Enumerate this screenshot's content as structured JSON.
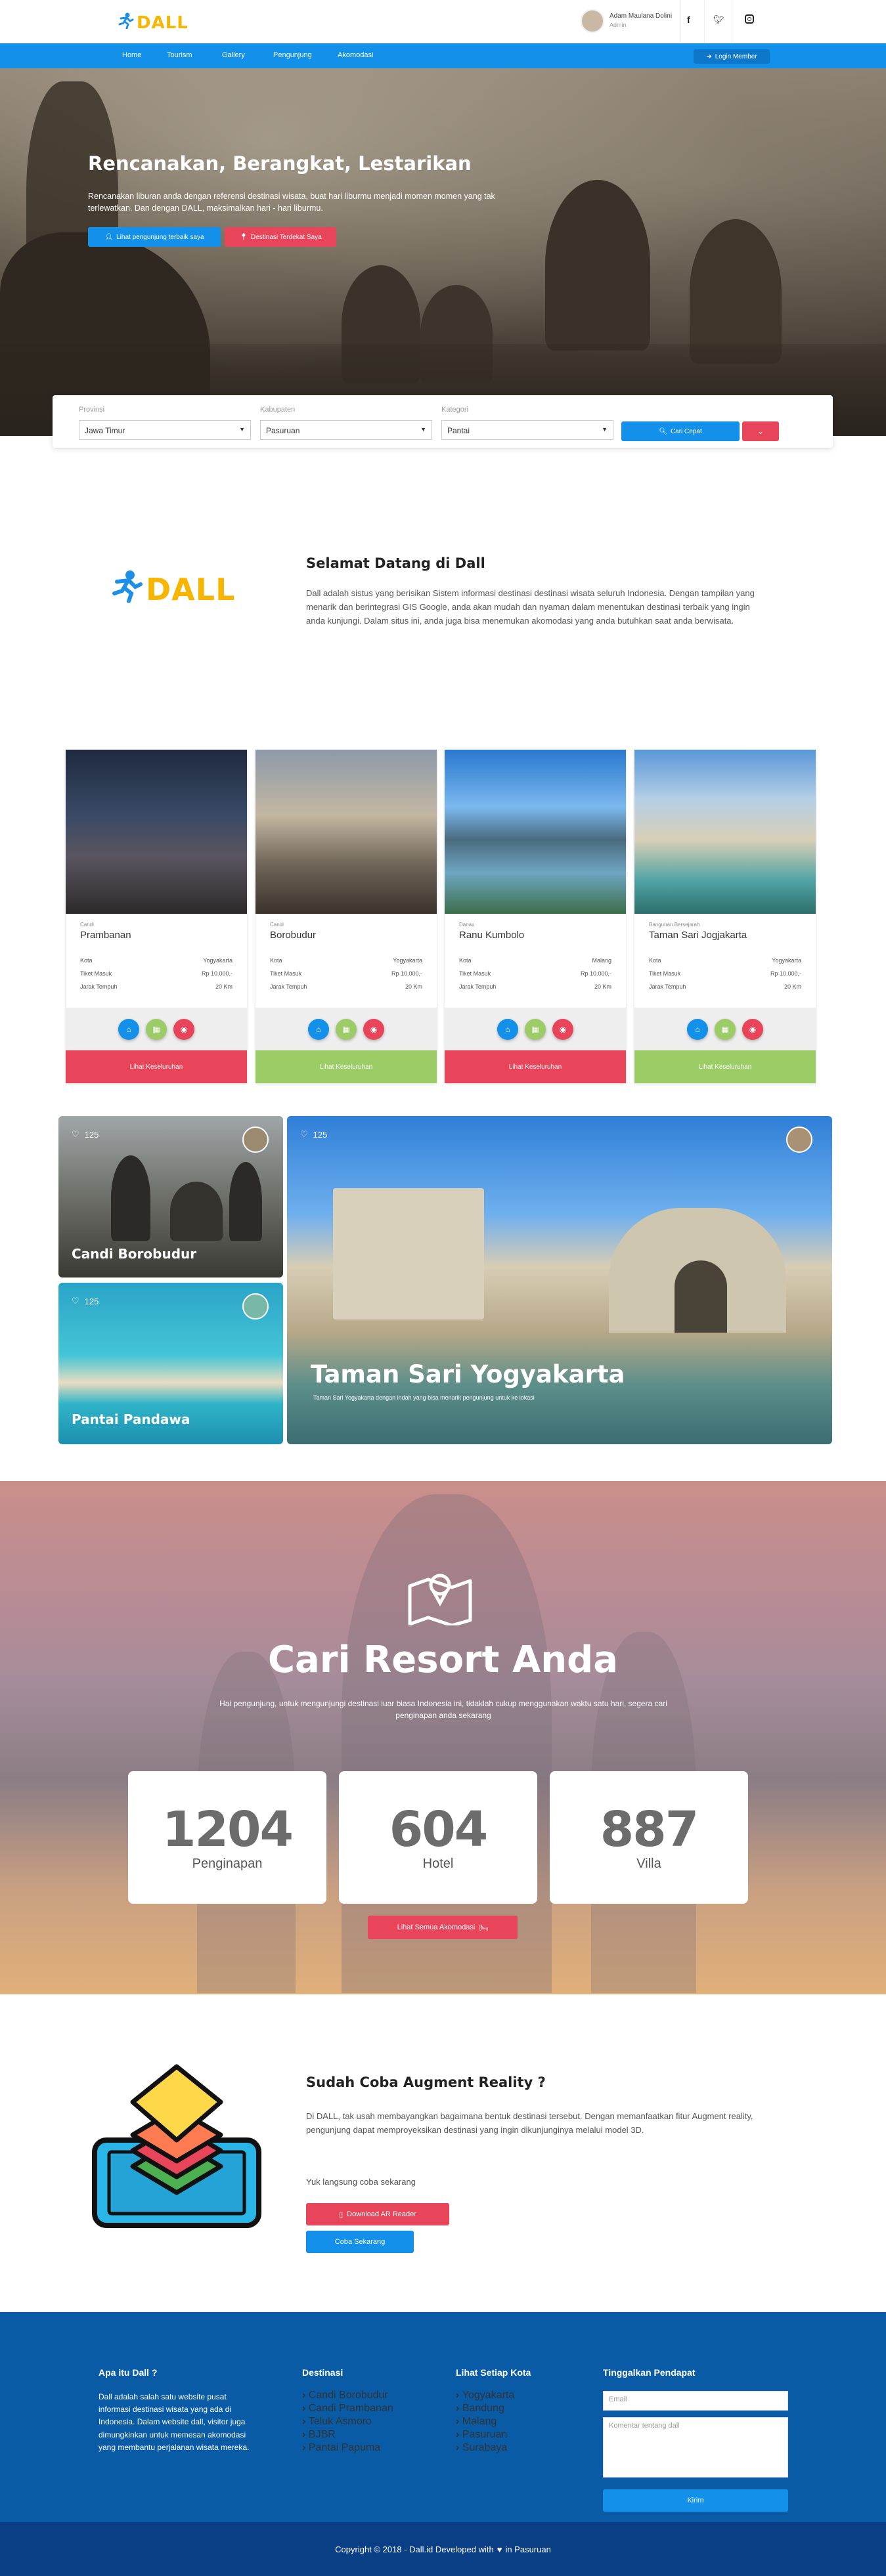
{
  "brand": {
    "logo_text": "DALL",
    "colors": {
      "primary": "#1391ea",
      "accent": "#f7b500",
      "danger": "#e8455a",
      "success": "#9ccc65",
      "footer": "#0a5ba5",
      "copyright_bar": "#0a3f85"
    }
  },
  "user": {
    "name": "Adam Maulana Dolini",
    "role": "Admin"
  },
  "social": [
    "facebook-icon",
    "twitter-icon",
    "instagram-icon"
  ],
  "nav": {
    "items": [
      "Home",
      "Tourism",
      "Gallery",
      "Pengunjung",
      "Akomodasi"
    ],
    "login": "Login Member"
  },
  "hero": {
    "title": "Rencanakan, Berangkat, Lestarikan",
    "text": "Rencanakan liburan anda dengan referensi destinasi wisata, buat hari liburmu menjadi momen momen yang tak terlewatkan. Dan dengan DALL, maksimalkan hari - hari liburmu.",
    "btn_primary": "Lihat pengunjung terbaik saya",
    "btn_secondary": "Destinasi Terdekat Saya"
  },
  "search": {
    "fields": [
      {
        "label": "Provinsi",
        "value": "Jawa Timur"
      },
      {
        "label": "Kabupaten",
        "value": "Pasuruan"
      },
      {
        "label": "Kategori",
        "value": "Pantai"
      }
    ],
    "search_label": "Cari Cepat"
  },
  "welcome": {
    "title": "Selamat Datang di Dall",
    "text": "Dall adalah sistus yang berisikan Sistem informasi destinasi destinasi wisata seluruh Indonesia. Dengan tampilan yang menarik dan berintegrasi GIS Google, anda akan mudah dan nyaman dalam menentukan destinasi terbaik yang ingin anda kunjungi. Dalam situs ini, anda juga bisa menemukan akomodasi yang anda butuhkan saat anda berwisata."
  },
  "destinations": [
    {
      "category": "Candi",
      "name": "Prambanan",
      "kota": "Yogyakarta",
      "tiket": "Rp 10.000,-",
      "jarak": "20 Km",
      "button": "Lihat Keseluruhan",
      "color": "#e8455a"
    },
    {
      "category": "Candi",
      "name": "Borobudur",
      "kota": "Yogyakarta",
      "tiket": "Rp 10.000,-",
      "jarak": "20 Km",
      "button": "Lihat Keseluruhan",
      "color": "#9ccc65"
    },
    {
      "category": "Danau",
      "name": "Ranu Kumbolo",
      "kota": "Malang",
      "tiket": "Rp 10.000,-",
      "jarak": "20 Km",
      "button": "Lihat Keseluruhan",
      "color": "#e8455a"
    },
    {
      "category": "Bangunan Bersejarah",
      "name": "Taman Sari Jogjakarta",
      "kota": "Yogyakarta",
      "tiket": "Rp 10.000,-",
      "jarak": "20 Km",
      "button": "Lihat Keseluruhan",
      "color": "#9ccc65"
    }
  ],
  "row_labels": {
    "kota": "Kota",
    "tiket": "Tiket Masuk",
    "jarak": "Jarak Tempuh"
  },
  "gallery": [
    {
      "likes": "125",
      "title": "Candi Borobudur"
    },
    {
      "likes": "125",
      "title": "Pantai Pandawa"
    },
    {
      "likes": "125",
      "title": "Taman Sari Yogyakarta",
      "subtitle": "Taman Sari Yogyakarta dengan indah yang bisa menarik pengunjung untuk ke lokasi"
    }
  ],
  "resort": {
    "title": "Cari Resort Anda",
    "text": "Hai pengunjung, untuk mengunjungi destinasi luar biasa Indonesia ini, tidaklah cukup menggunakan waktu satu hari, segera cari penginapan anda sekarang",
    "stats": [
      {
        "value": "1204",
        "label": "Penginapan"
      },
      {
        "value": "604",
        "label": "Hotel"
      },
      {
        "value": "887",
        "label": "Villa"
      }
    ],
    "button": "Lihat Semua Akomodasi"
  },
  "ar": {
    "title": "Sudah Coba Augment Reality ?",
    "text": "Di DALL, tak usah membayangkan bagaimana bentuk destinasi tersebut. Dengan memanfaatkan fitur Augment reality, pengunjung dapat memproyeksikan destinasi yang ingin dikunjunginya melalui model 3D.",
    "cta_text": "Yuk langsung coba sekarang",
    "download": "Download AR Reader",
    "try": "Coba Sekarang"
  },
  "footer": {
    "about_title": "Apa itu Dall ?",
    "about_text": "Dall adalah salah satu website pusat informasi destinasi wisata yang ada di Indonesia. Dalam website dall, visitor juga dimungkinkan untuk memesan akomodasi yang membantu perjalanan wisata mereka.",
    "dest_title": "Destinasi",
    "dest_items": [
      "Candi Borobudur",
      "Candi Prambanan",
      "Teluk Asmoro",
      "BJBR",
      "Pantai Papuma"
    ],
    "city_title": "Lihat Setiap Kota",
    "city_items": [
      "Yogyakarta",
      "Bandung",
      "Malang",
      "Pasuruan",
      "Surabaya"
    ],
    "feedback_title": "Tinggalkan Pendapat",
    "email_placeholder": "Email",
    "comment_placeholder": "Komentar tentang dall",
    "send": "Kirim",
    "copyright_pre": "Copyright © 2018 - Dall.id Developed with",
    "copyright_post": "in Pasuruan"
  }
}
